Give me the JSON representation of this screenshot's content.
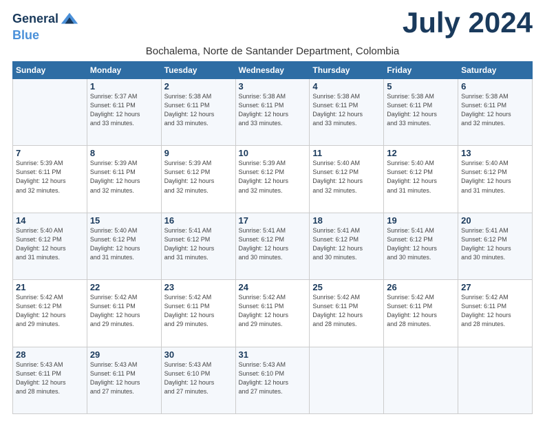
{
  "logo": {
    "line1": "General",
    "line2": "Blue"
  },
  "title": "July 2024",
  "subtitle": "Bochalema, Norte de Santander Department, Colombia",
  "weekdays": [
    "Sunday",
    "Monday",
    "Tuesday",
    "Wednesday",
    "Thursday",
    "Friday",
    "Saturday"
  ],
  "weeks": [
    [
      {
        "day": "",
        "sunrise": "",
        "sunset": "",
        "daylight": ""
      },
      {
        "day": "1",
        "sunrise": "Sunrise: 5:37 AM",
        "sunset": "Sunset: 6:11 PM",
        "daylight": "Daylight: 12 hours and 33 minutes."
      },
      {
        "day": "2",
        "sunrise": "Sunrise: 5:38 AM",
        "sunset": "Sunset: 6:11 PM",
        "daylight": "Daylight: 12 hours and 33 minutes."
      },
      {
        "day": "3",
        "sunrise": "Sunrise: 5:38 AM",
        "sunset": "Sunset: 6:11 PM",
        "daylight": "Daylight: 12 hours and 33 minutes."
      },
      {
        "day": "4",
        "sunrise": "Sunrise: 5:38 AM",
        "sunset": "Sunset: 6:11 PM",
        "daylight": "Daylight: 12 hours and 33 minutes."
      },
      {
        "day": "5",
        "sunrise": "Sunrise: 5:38 AM",
        "sunset": "Sunset: 6:11 PM",
        "daylight": "Daylight: 12 hours and 33 minutes."
      },
      {
        "day": "6",
        "sunrise": "Sunrise: 5:38 AM",
        "sunset": "Sunset: 6:11 PM",
        "daylight": "Daylight: 12 hours and 32 minutes."
      }
    ],
    [
      {
        "day": "7",
        "sunrise": "Sunrise: 5:39 AM",
        "sunset": "Sunset: 6:11 PM",
        "daylight": "Daylight: 12 hours and 32 minutes."
      },
      {
        "day": "8",
        "sunrise": "Sunrise: 5:39 AM",
        "sunset": "Sunset: 6:11 PM",
        "daylight": "Daylight: 12 hours and 32 minutes."
      },
      {
        "day": "9",
        "sunrise": "Sunrise: 5:39 AM",
        "sunset": "Sunset: 6:12 PM",
        "daylight": "Daylight: 12 hours and 32 minutes."
      },
      {
        "day": "10",
        "sunrise": "Sunrise: 5:39 AM",
        "sunset": "Sunset: 6:12 PM",
        "daylight": "Daylight: 12 hours and 32 minutes."
      },
      {
        "day": "11",
        "sunrise": "Sunrise: 5:40 AM",
        "sunset": "Sunset: 6:12 PM",
        "daylight": "Daylight: 12 hours and 32 minutes."
      },
      {
        "day": "12",
        "sunrise": "Sunrise: 5:40 AM",
        "sunset": "Sunset: 6:12 PM",
        "daylight": "Daylight: 12 hours and 31 minutes."
      },
      {
        "day": "13",
        "sunrise": "Sunrise: 5:40 AM",
        "sunset": "Sunset: 6:12 PM",
        "daylight": "Daylight: 12 hours and 31 minutes."
      }
    ],
    [
      {
        "day": "14",
        "sunrise": "Sunrise: 5:40 AM",
        "sunset": "Sunset: 6:12 PM",
        "daylight": "Daylight: 12 hours and 31 minutes."
      },
      {
        "day": "15",
        "sunrise": "Sunrise: 5:40 AM",
        "sunset": "Sunset: 6:12 PM",
        "daylight": "Daylight: 12 hours and 31 minutes."
      },
      {
        "day": "16",
        "sunrise": "Sunrise: 5:41 AM",
        "sunset": "Sunset: 6:12 PM",
        "daylight": "Daylight: 12 hours and 31 minutes."
      },
      {
        "day": "17",
        "sunrise": "Sunrise: 5:41 AM",
        "sunset": "Sunset: 6:12 PM",
        "daylight": "Daylight: 12 hours and 30 minutes."
      },
      {
        "day": "18",
        "sunrise": "Sunrise: 5:41 AM",
        "sunset": "Sunset: 6:12 PM",
        "daylight": "Daylight: 12 hours and 30 minutes."
      },
      {
        "day": "19",
        "sunrise": "Sunrise: 5:41 AM",
        "sunset": "Sunset: 6:12 PM",
        "daylight": "Daylight: 12 hours and 30 minutes."
      },
      {
        "day": "20",
        "sunrise": "Sunrise: 5:41 AM",
        "sunset": "Sunset: 6:12 PM",
        "daylight": "Daylight: 12 hours and 30 minutes."
      }
    ],
    [
      {
        "day": "21",
        "sunrise": "Sunrise: 5:42 AM",
        "sunset": "Sunset: 6:12 PM",
        "daylight": "Daylight: 12 hours and 29 minutes."
      },
      {
        "day": "22",
        "sunrise": "Sunrise: 5:42 AM",
        "sunset": "Sunset: 6:11 PM",
        "daylight": "Daylight: 12 hours and 29 minutes."
      },
      {
        "day": "23",
        "sunrise": "Sunrise: 5:42 AM",
        "sunset": "Sunset: 6:11 PM",
        "daylight": "Daylight: 12 hours and 29 minutes."
      },
      {
        "day": "24",
        "sunrise": "Sunrise: 5:42 AM",
        "sunset": "Sunset: 6:11 PM",
        "daylight": "Daylight: 12 hours and 29 minutes."
      },
      {
        "day": "25",
        "sunrise": "Sunrise: 5:42 AM",
        "sunset": "Sunset: 6:11 PM",
        "daylight": "Daylight: 12 hours and 28 minutes."
      },
      {
        "day": "26",
        "sunrise": "Sunrise: 5:42 AM",
        "sunset": "Sunset: 6:11 PM",
        "daylight": "Daylight: 12 hours and 28 minutes."
      },
      {
        "day": "27",
        "sunrise": "Sunrise: 5:42 AM",
        "sunset": "Sunset: 6:11 PM",
        "daylight": "Daylight: 12 hours and 28 minutes."
      }
    ],
    [
      {
        "day": "28",
        "sunrise": "Sunrise: 5:43 AM",
        "sunset": "Sunset: 6:11 PM",
        "daylight": "Daylight: 12 hours and 28 minutes."
      },
      {
        "day": "29",
        "sunrise": "Sunrise: 5:43 AM",
        "sunset": "Sunset: 6:11 PM",
        "daylight": "Daylight: 12 hours and 27 minutes."
      },
      {
        "day": "30",
        "sunrise": "Sunrise: 5:43 AM",
        "sunset": "Sunset: 6:10 PM",
        "daylight": "Daylight: 12 hours and 27 minutes."
      },
      {
        "day": "31",
        "sunrise": "Sunrise: 5:43 AM",
        "sunset": "Sunset: 6:10 PM",
        "daylight": "Daylight: 12 hours and 27 minutes."
      },
      {
        "day": "",
        "sunrise": "",
        "sunset": "",
        "daylight": ""
      },
      {
        "day": "",
        "sunrise": "",
        "sunset": "",
        "daylight": ""
      },
      {
        "day": "",
        "sunrise": "",
        "sunset": "",
        "daylight": ""
      }
    ]
  ]
}
